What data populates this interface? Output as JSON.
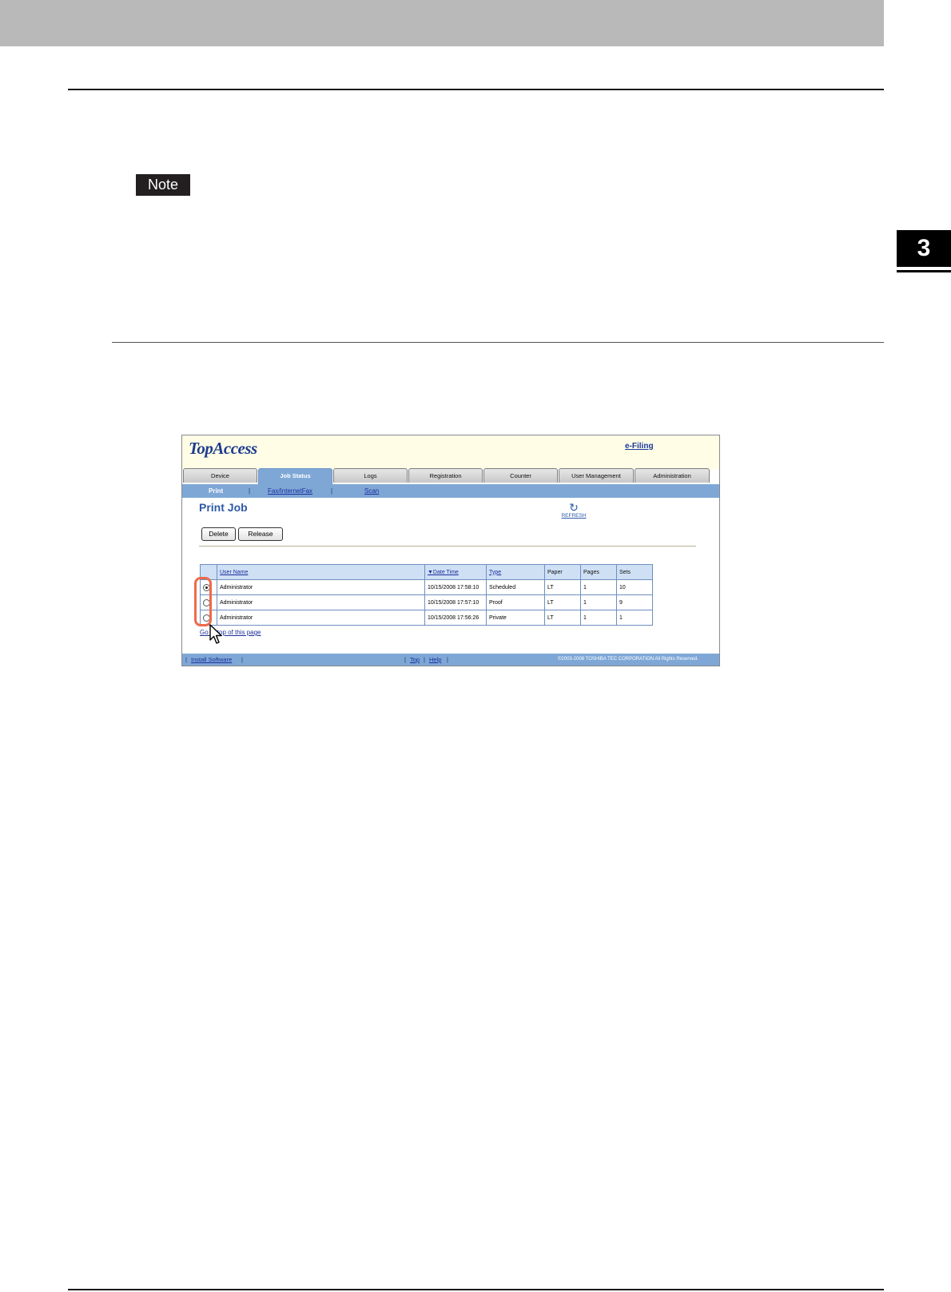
{
  "note_label": "Note",
  "chapter_number": "3",
  "app": {
    "logo": "TopAccess",
    "efiling_link": "e-Filing",
    "tabs": [
      "Device",
      "Job Status",
      "Logs",
      "Registration",
      "Counter",
      "User Management",
      "Administration"
    ],
    "active_tab": "Job Status",
    "subnav": {
      "print": "Print",
      "fax": "Fax/InternetFax",
      "scan": "Scan",
      "separator": "|"
    },
    "page_title": "Print Job",
    "refresh_label": "REFRESH",
    "buttons": {
      "delete": "Delete",
      "release": "Release"
    },
    "table": {
      "headers": {
        "user_name": "User Name",
        "date_time": "▼Date Time",
        "type": "Type",
        "paper": "Paper",
        "pages": "Pages",
        "sets": "Sets"
      },
      "rows": [
        {
          "selected": true,
          "user": "Administrator",
          "date": "10/15/2008 17:58:10",
          "type": "Scheduled",
          "paper": "LT",
          "pages": "1",
          "sets": "10"
        },
        {
          "selected": false,
          "user": "Administrator",
          "date": "10/15/2008 17:57:10",
          "type": "Proof",
          "paper": "LT",
          "pages": "1",
          "sets": "9"
        },
        {
          "selected": false,
          "user": "Administrator",
          "date": "10/15/2008 17:56:26",
          "type": "Private",
          "paper": "LT",
          "pages": "1",
          "sets": "1"
        }
      ]
    },
    "back_to_top": "Go to top of this page",
    "footer": {
      "install_software": "Install Software",
      "top": "Top",
      "help": "Help",
      "separator": "|",
      "copyright": "©2003-2008 TOSHIBA TEC CORPORATION All Rights Reserved."
    }
  }
}
